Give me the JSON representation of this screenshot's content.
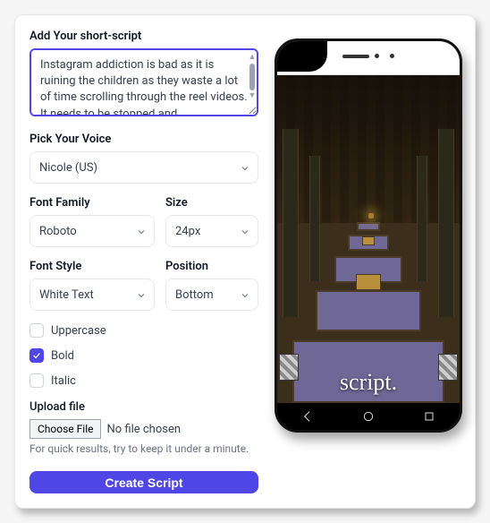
{
  "heading_script": "Add Your short-script",
  "script_value": "Instagram addiction is bad as it is ruining the children as they waste a lot of time scrolling through the reel videos. It needs to be stopped and ",
  "heading_voice": "Pick Your Voice",
  "voice_value": "Nicole (US)",
  "font_family_label": "Font Family",
  "font_family_value": "Roboto",
  "size_label": "Size",
  "size_value": "24px",
  "font_style_label": "Font Style",
  "font_style_value": "White Text",
  "position_label": "Position",
  "position_value": "Bottom",
  "cb_uppercase_label": "Uppercase",
  "cb_bold_label": "Bold",
  "cb_italic_label": "Italic",
  "upload_label": "Upload file",
  "choose_file_label": "Choose File",
  "file_status": "No file chosen",
  "upload_hint": "For quick results, try to keep it under a minute.",
  "create_btn": "Create Script",
  "preview_caption": "script.",
  "checkboxes": {
    "uppercase": false,
    "bold": true,
    "italic": false
  }
}
